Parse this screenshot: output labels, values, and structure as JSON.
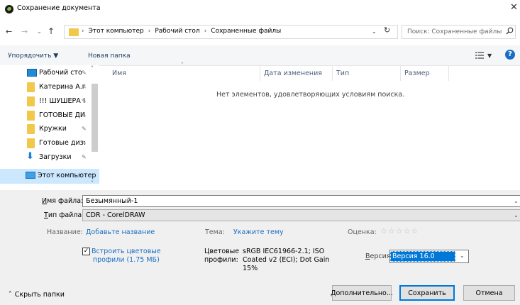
{
  "window": {
    "title": "Сохранение документа",
    "close_glyph": "✕"
  },
  "nav": {
    "back_glyph": "←",
    "forward_glyph": "→",
    "up_glyph": "↑",
    "breadcrumb": [
      "Этот компьютер",
      "Рабочий стол",
      "Сохраненные файлы"
    ],
    "search_placeholder": "Поиск: Сохраненные файлы"
  },
  "toolbar": {
    "organize_label": "Упорядочить ▼",
    "new_folder_label": "Новая папка",
    "view_dropdown": "▼",
    "help_glyph": "?"
  },
  "sidebar": {
    "items": [
      {
        "label": "Рабочий сто",
        "icon": "desktop-icon",
        "pinned": true
      },
      {
        "label": "Катерина А.г",
        "icon": "folder-icon",
        "pinned": true
      },
      {
        "label": "!!! ШУШЕРА !",
        "icon": "folder-icon",
        "pinned": true
      },
      {
        "label": "ГОТОВЫЕ ДИ",
        "icon": "folder-icon",
        "pinned": true
      },
      {
        "label": "Кружки",
        "icon": "folder-icon",
        "pinned": true
      },
      {
        "label": "Готовые диз:",
        "icon": "folder-icon",
        "pinned": true
      },
      {
        "label": "Загрузки",
        "icon": "download-icon",
        "pinned": true
      },
      {
        "label": "Этот компьютер",
        "icon": "computer-icon",
        "pinned": false,
        "selected": true
      }
    ]
  },
  "filelist": {
    "columns": [
      "Имя",
      "Дата изменения",
      "Тип",
      "Размер"
    ],
    "empty_message": "Нет элементов, удовлетворяющих условиям поиска."
  },
  "form": {
    "filename_label_u": "И",
    "filename_label_rest": "мя файла:",
    "filename_value": "Безымянный-1",
    "filetype_label_u": "Т",
    "filetype_label_rest": "ип файла:",
    "filetype_value": "CDR - CorelDRAW",
    "title_label": "Название:",
    "title_link": "Добавьте название",
    "subject_label": "Тема:",
    "subject_link": "Укажите тему",
    "rating_label": "Оценка:",
    "rating_stars": "☆☆☆☆☆",
    "embed_checked": true,
    "embed_label_line1": "Встроить цветовые",
    "embed_label_line2": "профили (1.75 МБ)",
    "color_profiles_label_line1": "Цветовые",
    "color_profiles_label_line2": "профили:",
    "color_profiles_value_line1": "sRGB IEC61966-2.1; ISO",
    "color_profiles_value_line2": "Coated v2 (ECI); Dot Gain",
    "color_profiles_value_line3": "15%",
    "version_label": "Версия:",
    "version_value": "Версия 16.0"
  },
  "buttons": {
    "hide_folders": "Скрыть папки",
    "advanced": "Дополнительно...",
    "save": "Сохранить",
    "cancel": "Отмена"
  },
  "colors": {
    "accent": "#0078d7",
    "link": "#1b6ec2",
    "folder": "#f2c84b",
    "selection": "#cce8ff"
  }
}
